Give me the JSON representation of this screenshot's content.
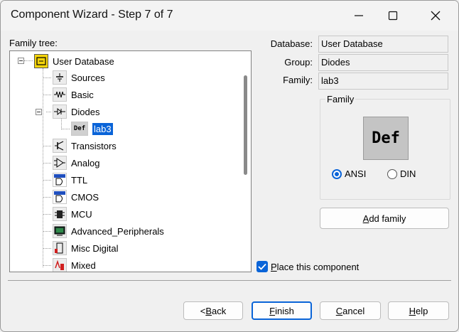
{
  "window": {
    "title": "Component Wizard - Step 7 of 7"
  },
  "tree": {
    "label": "Family tree:",
    "root": "User Database",
    "items": [
      {
        "label": "Sources",
        "icon": "sources-icon"
      },
      {
        "label": "Basic",
        "icon": "basic-icon"
      },
      {
        "label": "Diodes",
        "icon": "diode-icon"
      },
      {
        "label": "lab3",
        "icon": "def-icon",
        "icon_text": "Def",
        "selected": true
      },
      {
        "label": "Transistors",
        "icon": "transistor-icon"
      },
      {
        "label": "Analog",
        "icon": "opamp-icon"
      },
      {
        "label": "TTL",
        "icon": "ttl-icon"
      },
      {
        "label": "CMOS",
        "icon": "cmos-icon"
      },
      {
        "label": "MCU",
        "icon": "mcu-icon"
      },
      {
        "label": "Advanced_Peripherals",
        "icon": "peripherals-icon"
      },
      {
        "label": "Misc Digital",
        "icon": "misc-digital-icon"
      },
      {
        "label": "Mixed",
        "icon": "mixed-icon"
      }
    ]
  },
  "info": {
    "database_label": "Database:",
    "database_value": "User Database",
    "group_label": "Group:",
    "group_value": "Diodes",
    "family_label": "Family:",
    "family_value": "lab3"
  },
  "family_box": {
    "title": "Family",
    "preview_text": "Def",
    "ansi_label": "ANSI",
    "din_label": "DIN",
    "selected": "ANSI"
  },
  "add_family": {
    "pre": "",
    "ul": "A",
    "post": "dd family"
  },
  "place_component": {
    "pre": "",
    "ul": "P",
    "post": "lace this component",
    "checked": true
  },
  "buttons": {
    "back": {
      "pre": "< ",
      "ul": "B",
      "post": "ack"
    },
    "finish": {
      "pre": "",
      "ul": "F",
      "post": "inish"
    },
    "cancel": {
      "pre": "",
      "ul": "C",
      "post": "ancel"
    },
    "help": {
      "pre": "",
      "ul": "H",
      "post": "elp"
    }
  },
  "colors": {
    "accent": "#0a64d8"
  }
}
